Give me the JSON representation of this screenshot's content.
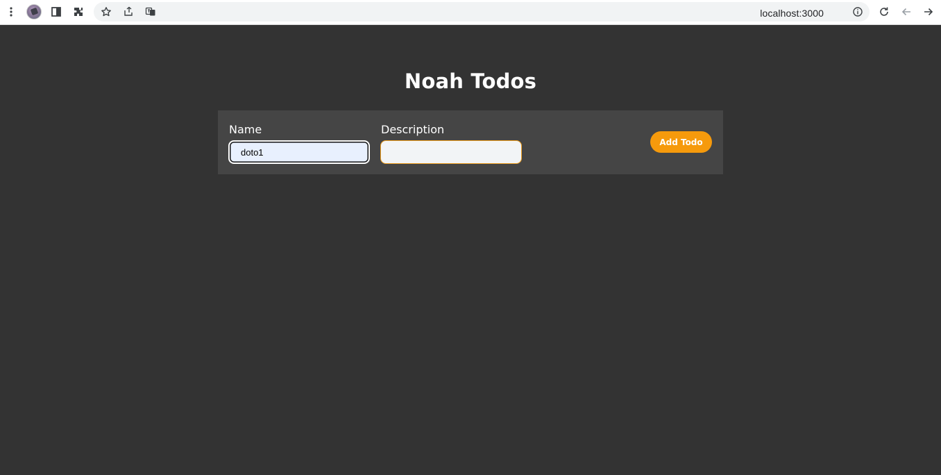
{
  "browser": {
    "url": "localhost:3000",
    "icons": [
      "kebab-menu-icon",
      "profile-avatar",
      "side-panel-icon",
      "extensions-icon",
      "bookmark-star-icon",
      "share-icon",
      "translate-icon",
      "site-info-icon",
      "reload-icon",
      "back-icon",
      "forward-icon"
    ]
  },
  "page": {
    "title": "Noah Todos"
  },
  "form": {
    "name_label": "Name",
    "name_value": "doto1",
    "description_label": "Description",
    "description_value": "",
    "add_button_label": "Add Todo"
  },
  "colors": {
    "background": "#333333",
    "panel": "#454545",
    "accent": "#f69a0c",
    "name_input_bg": "#e8f0fe"
  }
}
